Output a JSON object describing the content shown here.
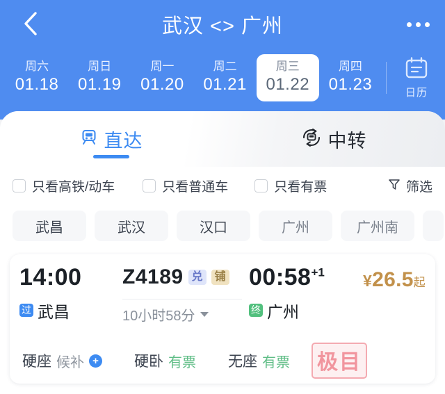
{
  "header": {
    "back_icon": "chevron-left-icon",
    "title": "武汉 <> 广州",
    "more_icon": "more-horizontal-icon"
  },
  "dates": {
    "items": [
      {
        "weekday": "周六",
        "date": "01.18",
        "active": false
      },
      {
        "weekday": "周日",
        "date": "01.19",
        "active": false
      },
      {
        "weekday": "周一",
        "date": "01.20",
        "active": false
      },
      {
        "weekday": "周二",
        "date": "01.21",
        "active": false
      },
      {
        "weekday": "周三",
        "date": "01.22",
        "active": true
      },
      {
        "weekday": "周四",
        "date": "01.23",
        "active": false
      }
    ],
    "calendar_label": "日历",
    "calendar_icon": "calendar-icon"
  },
  "tabs": [
    {
      "label": "直达",
      "icon": "train-icon",
      "active": true
    },
    {
      "label": "中转",
      "icon": "train-transfer-icon",
      "active": false
    }
  ],
  "filters": {
    "checkboxes": [
      {
        "label": "只看高铁/动车",
        "checked": false
      },
      {
        "label": "只看普通车",
        "checked": false
      },
      {
        "label": "只看有票",
        "checked": false
      }
    ],
    "filter_label": "筛选",
    "filter_icon": "funnel-icon"
  },
  "station_chips": [
    {
      "label": "武昌",
      "dim": false
    },
    {
      "label": "武汉",
      "dim": false
    },
    {
      "label": "汉口",
      "dim": false
    },
    {
      "label": "广州",
      "dim": true
    },
    {
      "label": "广州南",
      "dim": true
    }
  ],
  "result": {
    "depart_time": "14:00",
    "depart_badge": "过",
    "depart_station": "武昌",
    "train_no": "Z4189",
    "train_badges": [
      {
        "text": "兑",
        "style": "lav"
      },
      {
        "text": "铺",
        "style": "tan"
      }
    ],
    "duration": "10小时58分",
    "duration_caret_icon": "chevron-down-icon",
    "arrive_time": "00:58",
    "arrive_day_offset": "+1",
    "arrive_badge": "终",
    "arrive_station": "广州",
    "price_currency": "¥",
    "price_value": "26.5",
    "price_suffix": "起",
    "seats": [
      {
        "label": "硬座",
        "status": "候补",
        "available": false,
        "plus_icon": "plus-circle-icon"
      },
      {
        "label": "硬卧",
        "status": "有票",
        "available": true
      },
      {
        "label": "无座",
        "status": "有票",
        "available": true
      }
    ],
    "watermark": "极目"
  },
  "colors": {
    "brand_blue": "#4f8cf0",
    "tab_active": "#3d8bf2",
    "price_gold": "#c2914b",
    "available_green": "#5fbd86",
    "watermark_pink": "#f08d96"
  }
}
